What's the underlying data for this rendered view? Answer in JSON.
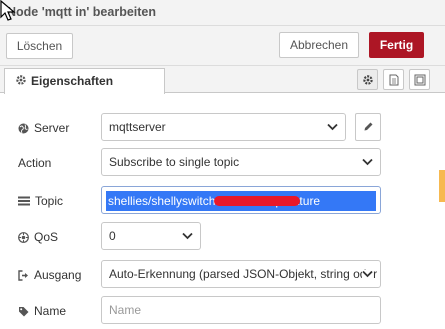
{
  "window": {
    "title": "Node 'mqtt in' bearbeiten"
  },
  "toolbar": {
    "delete_label": "Löschen",
    "cancel_label": "Abbrechen",
    "done_label": "Fertig",
    "done_color": "#ad1625"
  },
  "tabs": {
    "properties_label": "Eigenschaften"
  },
  "form": {
    "server": {
      "label": "Server",
      "value": "mqttserver"
    },
    "action": {
      "label": "Action",
      "value": "Subscribe to single topic"
    },
    "topic": {
      "label": "Topic",
      "value": "shellies/shellyswitch25 405/temperature"
    },
    "qos": {
      "label": "QoS",
      "value": "0"
    },
    "output": {
      "label": "Ausgang",
      "value": "Auto-Erkennung (parsed JSON-Objekt, string oder"
    },
    "name": {
      "label": "Name",
      "placeholder": "Name"
    }
  },
  "icons": {
    "server": "globe-icon",
    "action": "none",
    "topic": "tasks-icon",
    "qos": "empire-icon",
    "output": "sign-out-icon",
    "name": "tag-icon",
    "edit": "pencil-icon",
    "tab_settings": "gear-icon",
    "tab_description": "file-text-icon",
    "tab_appearance": "image-icon"
  }
}
